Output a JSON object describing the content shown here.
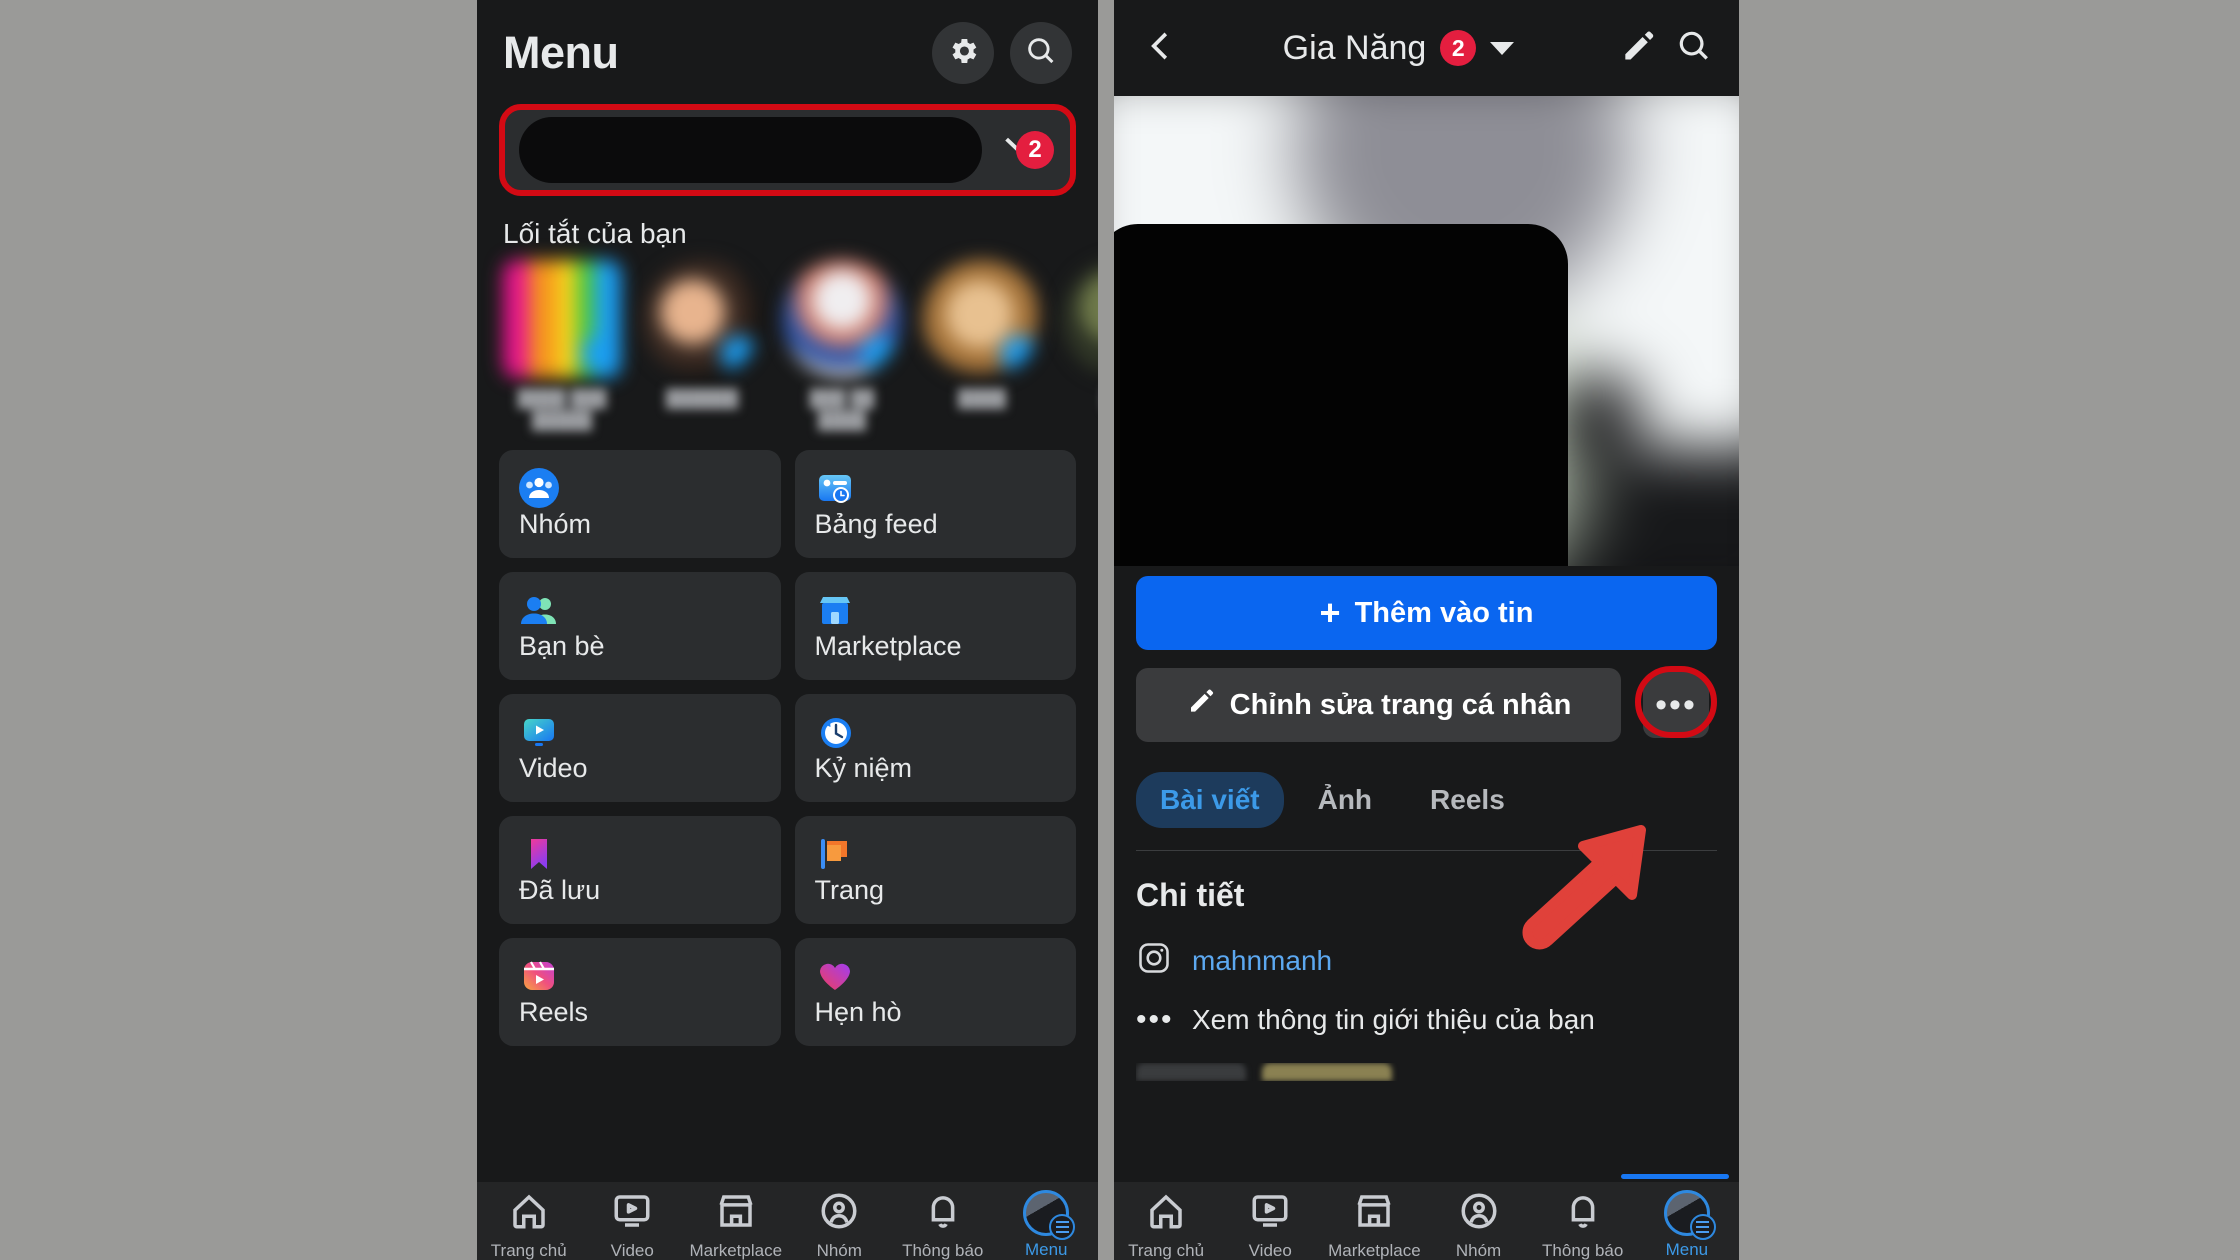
{
  "left_panel": {
    "header": {
      "title": "Menu",
      "settings_icon": "gear-icon",
      "search_icon": "search-icon"
    },
    "account_row": {
      "redacted": true,
      "badge_count": "2",
      "chevron_icon": "chevron-down-icon",
      "highlight_color": "#d30a14"
    },
    "shortcuts": {
      "title": "Lối tắt của bạn",
      "items": [
        {
          "label": "",
          "shape": "square",
          "has_badge": true
        },
        {
          "label": "",
          "shape": "circle",
          "has_badge": true
        },
        {
          "label": "",
          "shape": "circle",
          "has_badge": true
        },
        {
          "label": "",
          "shape": "circle",
          "has_badge": true
        },
        {
          "label": "",
          "shape": "circle",
          "has_badge": false
        }
      ]
    },
    "tiles": [
      {
        "label": "Nhóm",
        "icon": "groups-icon"
      },
      {
        "label": "Bảng feed",
        "icon": "feeds-icon"
      },
      {
        "label": "Bạn bè",
        "icon": "friends-icon"
      },
      {
        "label": "Marketplace",
        "icon": "marketplace-icon"
      },
      {
        "label": "Video",
        "icon": "video-icon"
      },
      {
        "label": "Kỷ niệm",
        "icon": "memories-icon"
      },
      {
        "label": "Đã lưu",
        "icon": "saved-icon"
      },
      {
        "label": "Trang",
        "icon": "pages-icon"
      },
      {
        "label": "Reels",
        "icon": "reels-icon"
      },
      {
        "label": "Hẹn hò",
        "icon": "dating-icon"
      }
    ],
    "bottom_nav": [
      {
        "label": "Trang chủ",
        "icon": "home-icon",
        "active": false
      },
      {
        "label": "Video",
        "icon": "video-icon",
        "active": false
      },
      {
        "label": "Marketplace",
        "icon": "marketplace-icon",
        "active": false
      },
      {
        "label": "Nhóm",
        "icon": "groups-icon",
        "active": false
      },
      {
        "label": "Thông báo",
        "icon": "bell-icon",
        "active": false
      },
      {
        "label": "Menu",
        "icon": "avatar-menu-icon",
        "active": true
      }
    ]
  },
  "right_panel": {
    "header": {
      "back_icon": "back-chevron-icon",
      "title": "Gia Năng",
      "badge_count": "2",
      "caret_icon": "caret-down-icon",
      "edit_icon": "pencil-icon",
      "search_icon": "search-icon"
    },
    "cover": {
      "redacted": true,
      "blurred": true
    },
    "actions": {
      "primary_label": "Thêm vào tin",
      "primary_plus": "+",
      "primary_color": "#0a66f0",
      "secondary_label": "Chỉnh sửa trang cá nhân",
      "secondary_icon": "pencil-icon",
      "more_label": "•••",
      "more_highlighted": true,
      "highlight_color": "#d30a14"
    },
    "annotation": {
      "type": "arrow",
      "direction": "up-right",
      "color": "#e0413a"
    },
    "tabs": [
      {
        "label": "Bài viết",
        "active": true
      },
      {
        "label": "Ảnh",
        "active": false
      },
      {
        "label": "Reels",
        "active": false
      }
    ],
    "details": {
      "section_title": "Chi tiết",
      "rows": [
        {
          "icon": "instagram-icon",
          "text": "mahnmanh",
          "style": "link"
        },
        {
          "icon": "dots-icon",
          "text": "Xem thông tin giới thiệu của bạn",
          "style": "plain"
        }
      ]
    },
    "bottom_nav": [
      {
        "label": "Trang chủ",
        "icon": "home-icon",
        "active": false
      },
      {
        "label": "Video",
        "icon": "video-icon",
        "active": false
      },
      {
        "label": "Marketplace",
        "icon": "marketplace-icon",
        "active": false
      },
      {
        "label": "Nhóm",
        "icon": "groups-icon",
        "active": false
      },
      {
        "label": "Thông báo",
        "icon": "bell-icon",
        "active": false
      },
      {
        "label": "Menu",
        "icon": "avatar-menu-icon",
        "active": true
      }
    ]
  }
}
